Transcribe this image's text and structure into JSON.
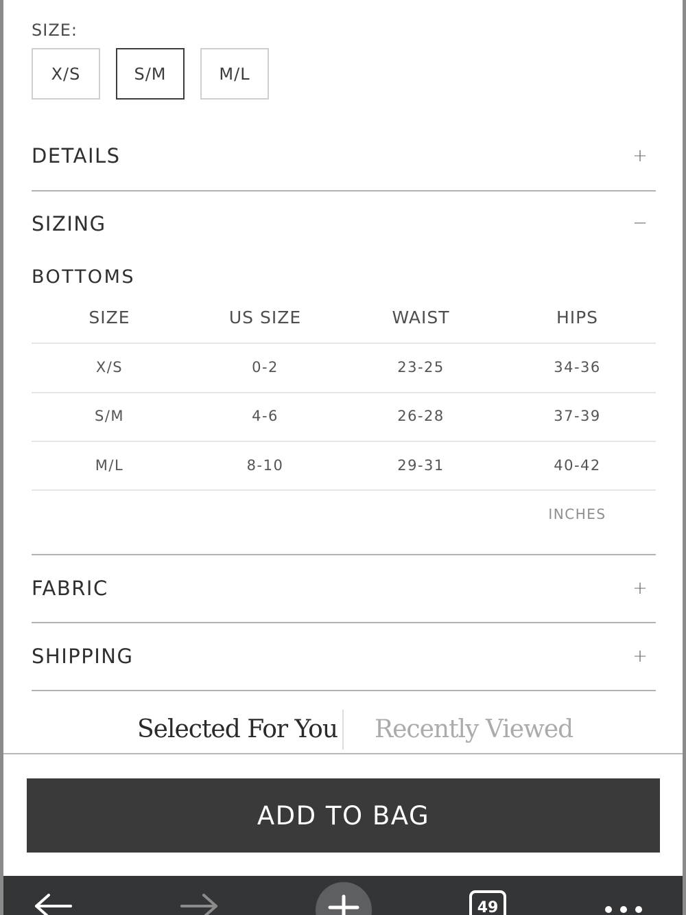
{
  "size_selector": {
    "label": "SIZE:",
    "options": [
      "X/S",
      "S/M",
      "M/L"
    ],
    "selected": "S/M"
  },
  "accordions": {
    "details": {
      "title": "DETAILS",
      "toggle": "+"
    },
    "sizing": {
      "title": "SIZING",
      "toggle": "−"
    },
    "fabric": {
      "title": "FABRIC",
      "toggle": "+"
    },
    "shipping": {
      "title": "SHIPPING",
      "toggle": "+"
    }
  },
  "sizing_table": {
    "title": "BOTTOMS",
    "headers": [
      "SIZE",
      "US SIZE",
      "WAIST",
      "HIPS"
    ],
    "rows": [
      [
        "X/S",
        "0-2",
        "23-25",
        "34-36"
      ],
      [
        "S/M",
        "4-6",
        "26-28",
        "37-39"
      ],
      [
        "M/L",
        "8-10",
        "29-31",
        "40-42"
      ]
    ],
    "unit": "INCHES"
  },
  "recommendations": {
    "tabs": [
      "Selected For You",
      "Recently Viewed"
    ],
    "active": "Selected For You"
  },
  "cta": {
    "add_to_bag": "ADD TO BAG"
  },
  "browser_toolbar": {
    "tab_count": "49",
    "icons": [
      "back-arrow-icon",
      "forward-arrow-icon",
      "new-tab-plus-icon",
      "tabs-count-icon",
      "more-dots-icon"
    ],
    "colors": {
      "bar": "#343536",
      "icon": "#ffffff",
      "disabled_icon": "#8c8c8c",
      "plus_circle": "#5e5f61"
    }
  },
  "colors": {
    "cta_bg": "#3a3a3a",
    "text": "#3c3c3c",
    "divider": "#b3b3b3"
  }
}
